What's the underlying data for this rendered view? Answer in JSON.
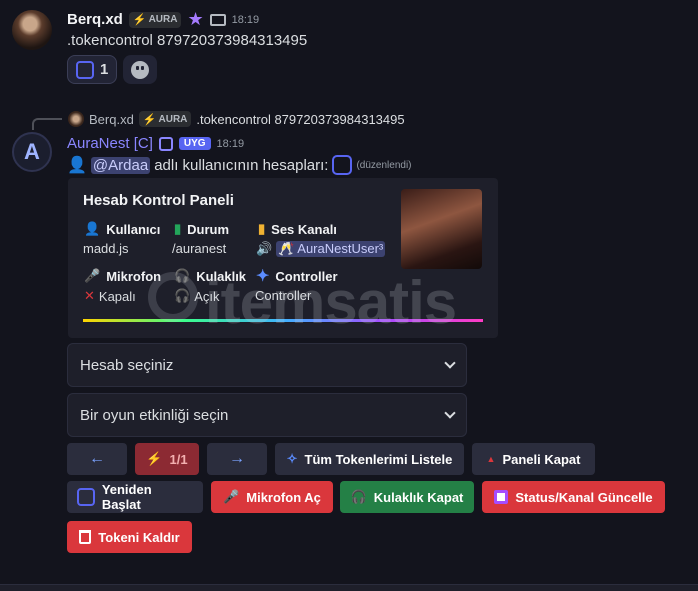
{
  "msg1": {
    "author": "Berq.xd",
    "tag": "AURA",
    "time": "18:19",
    "text": ".tokencontrol 879720373984313495",
    "reaction_count": "1"
  },
  "reply": {
    "author": "Berq.xd",
    "tag": "AURA",
    "text": ".tokencontrol 879720373984313495"
  },
  "msg2": {
    "author": "AuraNest [C]",
    "badge": "UYG",
    "time": "18:19",
    "mention": "@Ardaa",
    "text": " adlı kullanıcının hesapları:",
    "edited": "(düzenlendi)"
  },
  "embed": {
    "title": "Hesab Kontrol Paneli",
    "fields": [
      {
        "name": "Kullanıcı",
        "value": "madd.js"
      },
      {
        "name": "Durum",
        "value": "/auranest"
      },
      {
        "name": "Ses Kanalı",
        "value": "🥂 AuraNestUser³"
      },
      {
        "name": "Mikrofon",
        "value": "Kapalı"
      },
      {
        "name": "Kulaklık",
        "value": "Açık"
      },
      {
        "name": "Controller",
        "value": "Controller"
      }
    ]
  },
  "selects": {
    "account_placeholder": "Hesab seçiniz",
    "activity_placeholder": "Bir oyun etkinliği seçin"
  },
  "buttons": {
    "prev": "←",
    "page": "1/1",
    "next": "→",
    "list_tokens": "Tüm Tokenlerimi Listele",
    "close_panel": "Paneli Kapat",
    "restart": "Yeniden Başlat",
    "mic_on": "Mikrofon Aç",
    "headphone_off": "Kulaklık Kapat",
    "status_update": "Status/Kanal Güncelle",
    "remove_token": "Tokeni Kaldır"
  },
  "watermark": "itemsatis",
  "colors": {
    "accent": "#5865f2",
    "danger": "#da373c",
    "success": "#248046"
  }
}
